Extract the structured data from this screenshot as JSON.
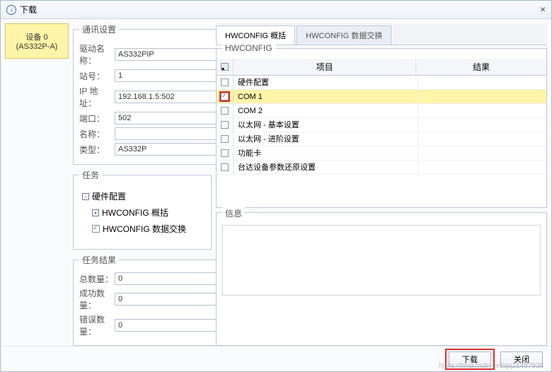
{
  "title": "下载",
  "device": {
    "label": "设备 0 (AS332P-A)"
  },
  "comm": {
    "legend": "通讯设置",
    "driver_label": "驱动名称：",
    "driver": "AS332PIP",
    "station_label": "站号：",
    "station": "1",
    "ip_label": "IP 地址：",
    "ip": "192.168.1.5:502",
    "port_label": "端口：",
    "port": "502",
    "name_label": "名称：",
    "name": "",
    "type_label": "类型：",
    "type": "AS332P"
  },
  "tasks": {
    "legend": "任务",
    "root": "硬件配置",
    "child1": "HWCONFIG 概括",
    "child2": "HWCONFIG 数据交换"
  },
  "task_results": {
    "legend": "任务结果",
    "total_label": "总数量：",
    "total": "0",
    "success_label": "成功数量：",
    "success": "0",
    "error_label": "错误数量：",
    "error": "0"
  },
  "tabs": {
    "t1": "HWCONFIG 概括",
    "t2": "HWCONFIG 数据交换"
  },
  "hwconfig": {
    "legend": "HWCONFIG",
    "col_item": "项目",
    "col_result": "结果",
    "rows": [
      {
        "label": "硬件配置",
        "checked": false,
        "sel": false
      },
      {
        "label": "COM 1",
        "checked": true,
        "sel": true
      },
      {
        "label": "COM 2",
        "checked": false,
        "sel": false
      },
      {
        "label": "以太网 - 基本设置",
        "checked": false,
        "sel": false
      },
      {
        "label": "以太网 - 进阶设置",
        "checked": false,
        "sel": false
      },
      {
        "label": "功能卡",
        "checked": false,
        "sel": false
      },
      {
        "label": "台达设备参数还原设置",
        "checked": false,
        "sel": false
      }
    ]
  },
  "messages": {
    "legend": "信息"
  },
  "buttons": {
    "download": "下载",
    "close": "关闭"
  },
  "watermark": "https://blog.csdn.net/qq21497936"
}
